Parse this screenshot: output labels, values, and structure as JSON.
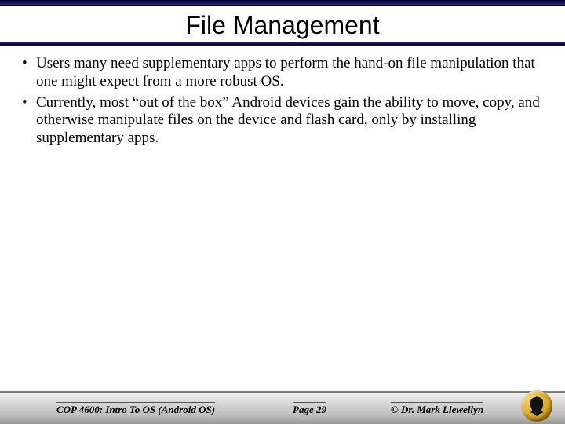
{
  "title": "File Management",
  "bullets": [
    "Users many need supplementary apps to perform the hand-on file manipulation that one might expect from a more robust OS.",
    "Currently, most “out of the box” Android devices gain the ability to move, copy, and otherwise manipulate files on the device and flash card, only by installing supplementary apps."
  ],
  "footer": {
    "course": "COP 4600: Intro To OS  (Android OS)",
    "page": "Page 29",
    "author": "© Dr. Mark Llewellyn"
  }
}
